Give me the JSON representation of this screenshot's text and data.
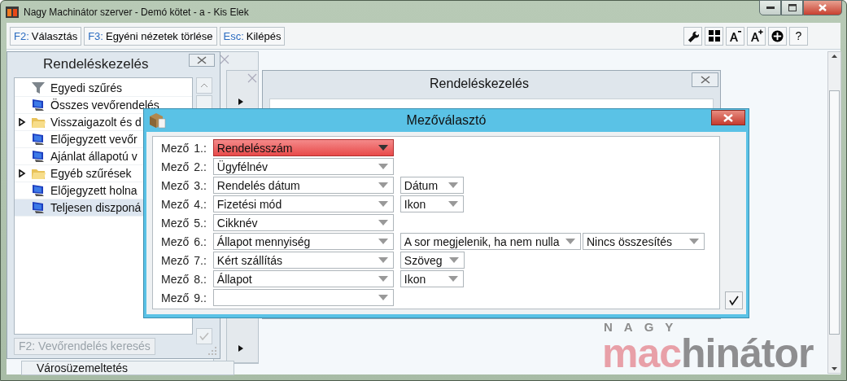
{
  "window": {
    "title": "Nagy Machinátor szerver - Demó kötet - a - Kis Elek"
  },
  "toolbar": {
    "commands": [
      {
        "key": "F2:",
        "label": "Választás"
      },
      {
        "key": "F3:",
        "label": "Egyéni nézetek törlése"
      },
      {
        "key": "Esc:",
        "label": "Kilépés"
      }
    ],
    "tools": [
      {
        "kind": "wrench"
      },
      {
        "kind": "grid"
      },
      {
        "kind": "font-smaller"
      },
      {
        "kind": "font-larger"
      },
      {
        "kind": "circle"
      },
      {
        "kind": "help",
        "label": "?"
      }
    ]
  },
  "side_panel": {
    "title": "Rendeléskezelés",
    "items": [
      {
        "kind": "filter",
        "label": "Egyedi szűrés",
        "selected": false
      },
      {
        "kind": "computer",
        "label": "Összes vevőrendelés",
        "selected": false
      },
      {
        "kind": "folder",
        "label": "Visszaigazolt és d",
        "selected": false,
        "expanded": false
      },
      {
        "kind": "computer",
        "label": "Előjegyzett vevőr",
        "selected": false
      },
      {
        "kind": "computer",
        "label": "Ajánlat állapotú v",
        "selected": false
      },
      {
        "kind": "folder",
        "label": "Egyéb szűrések",
        "selected": false,
        "expanded": false
      },
      {
        "kind": "computer",
        "label": "Előjegyzett holna",
        "selected": false
      },
      {
        "kind": "computer",
        "label": "Teljesen diszponá",
        "selected": true
      }
    ],
    "search_button": {
      "label": "F2: Vevőrendelés keresés",
      "disabled": true
    }
  },
  "back_menu": {
    "item": "Városüzemeltetés"
  },
  "order_window": {
    "title": "Rendeléskezelés"
  },
  "field_dialog": {
    "title": "Mezőválasztó",
    "rows": [
      {
        "label": "Mező",
        "number": "1.:",
        "value": "Rendelésszám",
        "selected": true
      },
      {
        "label": "Mező",
        "number": "2.:",
        "value": "Ügyfélnév",
        "selected": false
      },
      {
        "label": "Mező",
        "number": "3.:",
        "value": "Rendelés dátum",
        "selected": false,
        "format": "Dátum"
      },
      {
        "label": "Mező",
        "number": "4.:",
        "value": "Fizetési mód",
        "selected": false,
        "format": "Ikon"
      },
      {
        "label": "Mező",
        "number": "5.:",
        "value": "Cikknév",
        "selected": false
      },
      {
        "label": "Mező",
        "number": "6.:",
        "value": "Állapot mennyiség",
        "selected": false,
        "format": "A sor megjelenik, ha nem nulla",
        "summary": "Nincs összesítés"
      },
      {
        "label": "Mező",
        "number": "7.:",
        "value": "Kért szállítás",
        "selected": false,
        "format": "Szöveg"
      },
      {
        "label": "Mező",
        "number": "8.:",
        "value": "Állapot",
        "selected": false,
        "format": "Ikon"
      },
      {
        "label": "Mező",
        "number": "9.:",
        "selected": false
      }
    ]
  },
  "logo": {
    "tagline": "NAGY",
    "word_parts": [
      "mac",
      "hinátor"
    ]
  }
}
